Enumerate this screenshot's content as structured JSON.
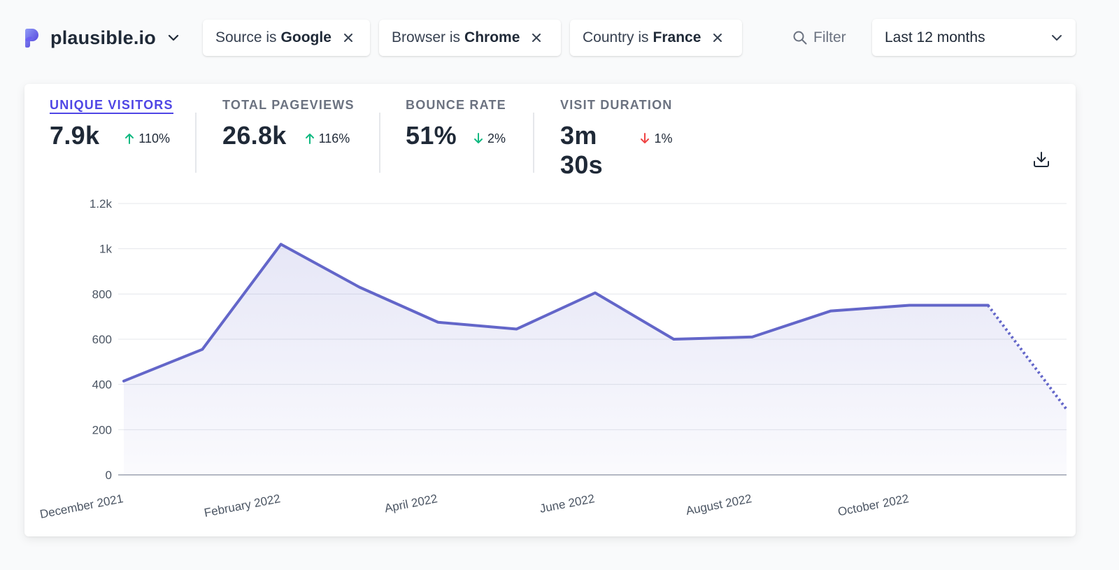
{
  "site": {
    "name": "plausible.io"
  },
  "filters": [
    {
      "prefix": "Source is",
      "value": "Google"
    },
    {
      "prefix": "Browser is",
      "value": "Chrome"
    },
    {
      "prefix": "Country is",
      "value": "France"
    }
  ],
  "filter_button": {
    "label": "Filter"
  },
  "period": {
    "selected": "Last 12 months"
  },
  "stats": [
    {
      "label": "UNIQUE VISITORS",
      "value": "7.9k",
      "change": "110%",
      "direction": "up",
      "active": true
    },
    {
      "label": "TOTAL PAGEVIEWS",
      "value": "26.8k",
      "change": "116%",
      "direction": "up",
      "active": false
    },
    {
      "label": "BOUNCE RATE",
      "value": "51%",
      "change": "2%",
      "direction": "down-good",
      "active": false
    },
    {
      "label": "VISIT DURATION",
      "value": "3m 30s",
      "change": "1%",
      "direction": "down-bad",
      "active": false
    }
  ],
  "colors": {
    "accent": "#4f46e5",
    "line": "#6366c9",
    "positive": "#10b981",
    "negative": "#ef4444"
  },
  "icons": {
    "logo": "plausible-logo-icon",
    "dropdown": "chevron-down-icon",
    "remove": "close-icon",
    "search": "search-icon",
    "download": "download-icon",
    "up": "arrow-up-icon",
    "down": "arrow-down-icon"
  },
  "chart_data": {
    "type": "area",
    "x": [
      "2021-12",
      "2022-01",
      "2022-02",
      "2022-03",
      "2022-04",
      "2022-05",
      "2022-06",
      "2022-07",
      "2022-08",
      "2022-09",
      "2022-10",
      "2022-11",
      "2022-12"
    ],
    "x_tick_labels": [
      "December 2021",
      "February 2022",
      "April 2022",
      "June 2022",
      "August 2022",
      "October 2022"
    ],
    "x_tick_index": [
      0,
      2,
      4,
      6,
      8,
      10
    ],
    "series": [
      {
        "values": [
          415,
          555,
          1020,
          830,
          675,
          645,
          805,
          600,
          610,
          725,
          750,
          750,
          290
        ]
      }
    ],
    "incomplete_from_index": 11,
    "ylim": [
      0,
      1200
    ],
    "y_ticks": [
      0,
      200,
      400,
      600,
      800,
      1000,
      1200
    ],
    "y_tick_labels": [
      "0",
      "200",
      "400",
      "600",
      "800",
      "1k",
      "1.2k"
    ],
    "grid": true,
    "legend": "none"
  }
}
